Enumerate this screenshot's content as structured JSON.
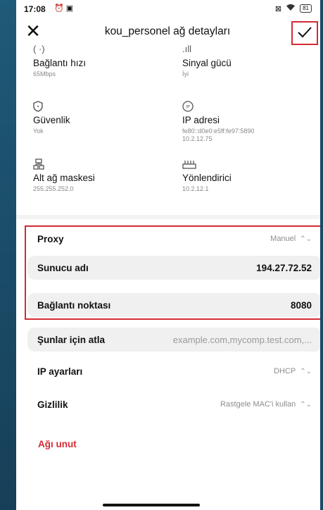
{
  "status_bar": {
    "time": "17:08",
    "battery": "81"
  },
  "header": {
    "title": "kou_personel ağ detayları"
  },
  "network_info": [
    {
      "icon": "link-speed-icon",
      "label": "Bağlantı hızı",
      "value": "65Mbps"
    },
    {
      "icon": "signal-icon",
      "label": "Sinyal gücü",
      "value": "İyi"
    },
    {
      "icon": "shield-icon",
      "label": "Güvenlik",
      "value": "Yok"
    },
    {
      "icon": "ip-icon",
      "label": "IP adresi",
      "value": "fe80::d0e0:e5ff:fe97:5890",
      "value2": "10.2.12.75"
    },
    {
      "icon": "subnet-icon",
      "label": "Alt ağ maskesi",
      "value": "255.255.252.0"
    },
    {
      "icon": "router-icon",
      "label": "Yönlendirici",
      "value": "10.2.12.1"
    }
  ],
  "settings": {
    "proxy": {
      "label": "Proxy",
      "value": "Manuel"
    },
    "server": {
      "label": "Sunucu adı",
      "value": "194.27.72.52"
    },
    "port": {
      "label": "Bağlantı noktası",
      "value": "8080"
    },
    "bypass": {
      "label": "Şunlar için atla",
      "placeholder": "example.com,mycomp.test.com,..."
    },
    "ip_settings": {
      "label": "IP ayarları",
      "value": "DHCP"
    },
    "privacy": {
      "label": "Gizlilik",
      "value": "Rastgele MAC'i kullan"
    },
    "forget": {
      "label": "Ağı unut"
    }
  },
  "colors": {
    "accent_red": "#d42b36",
    "field_bg": "#f0f0f0",
    "background": "#1b4e6c"
  }
}
